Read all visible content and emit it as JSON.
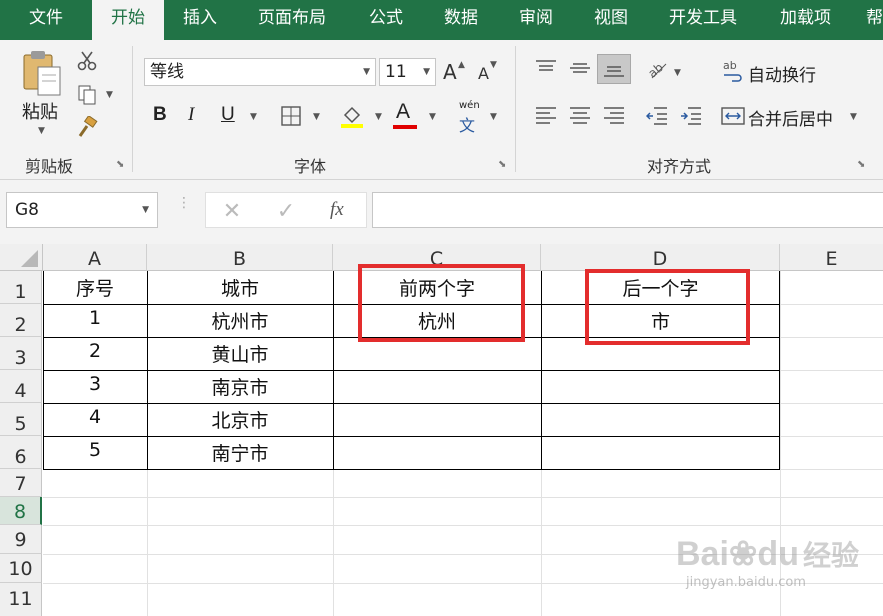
{
  "tabs": [
    {
      "label": "文件",
      "active": false
    },
    {
      "label": "开始",
      "active": true
    },
    {
      "label": "插入",
      "active": false
    },
    {
      "label": "页面布局",
      "active": false
    },
    {
      "label": "公式",
      "active": false
    },
    {
      "label": "数据",
      "active": false
    },
    {
      "label": "审阅",
      "active": false
    },
    {
      "label": "视图",
      "active": false
    },
    {
      "label": "开发工具",
      "active": false
    },
    {
      "label": "加载项",
      "active": false
    },
    {
      "label": "帮",
      "active": false
    }
  ],
  "ribbon": {
    "clipboard": {
      "group_label": "剪贴板",
      "paste_label": "粘贴"
    },
    "font": {
      "group_label": "字体",
      "font_name": "等线",
      "font_size": "11",
      "bold_label": "B",
      "italic_label": "I",
      "underline_label": "U",
      "grow_label": "A",
      "shrink_label": "A",
      "font_color_label": "A",
      "phonetic_top": "wén",
      "phonetic_bottom": "文",
      "highlight_color": "#ffff00",
      "font_color": "#e00000"
    },
    "alignment": {
      "group_label": "对齐方式",
      "wrap_text_label": "自动换行",
      "merge_center_label": "合并后居中",
      "wrap_icon_glyph": "ab"
    }
  },
  "formula_bar": {
    "name_box": "G8",
    "fx_label": "fx",
    "formula": ""
  },
  "sheet": {
    "columns": [
      "A",
      "B",
      "C",
      "D",
      "E"
    ],
    "rows": [
      "1",
      "2",
      "3",
      "4",
      "5",
      "6",
      "7",
      "8",
      "9",
      "10",
      "11"
    ],
    "selected_row": "8",
    "cells": {
      "A1": "序号",
      "B1": "城市",
      "C1": "前两个字",
      "D1": "后一个字",
      "A2": "1",
      "B2": "杭州市",
      "C2": "杭州",
      "D2": "市",
      "A3": "2",
      "B3": "黄山市",
      "A4": "3",
      "B4": "南京市",
      "A5": "4",
      "B5": "北京市",
      "A6": "5",
      "B6": "南宁市"
    }
  },
  "watermark": {
    "main": "Bai",
    "paw": "du",
    "suffix": "经验",
    "url": "jingyan.baidu.com"
  },
  "colors": {
    "accent": "#217346",
    "highlight_box": "#e32d2d"
  }
}
